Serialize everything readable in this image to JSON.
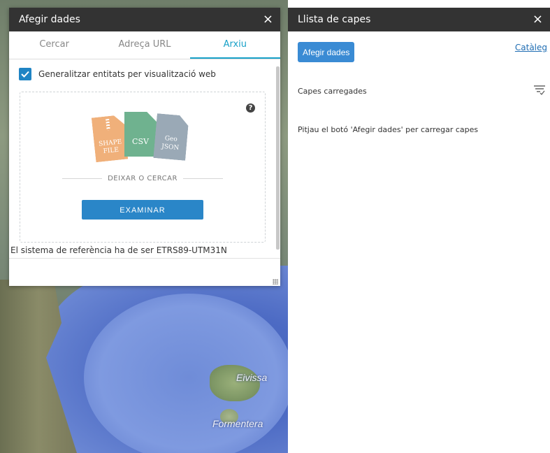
{
  "map": {
    "labels": {
      "eivissa": "Eivissa",
      "formentera": "Formentera"
    }
  },
  "add_data_panel": {
    "title": "Afegir dades",
    "close_icon": "×",
    "tabs": [
      {
        "label": "Cercar",
        "active": false
      },
      {
        "label": "Adreça URL",
        "active": false
      },
      {
        "label": "Arxiu",
        "active": true
      }
    ],
    "generalize_checkbox": {
      "label": "Generalitzar entitats per visualització web",
      "checked": true
    },
    "help_icon": "?",
    "file_types": {
      "shapefile_line1": "SHAPE",
      "shapefile_line2": "FILE",
      "csv": "CSV",
      "geojson_line1": "Geo",
      "geojson_line2": "JSON"
    },
    "drop_or_search": "DEIXAR O CERCAR",
    "browse_button": "EXAMINAR",
    "crs_note": "El sistema de referència ha de ser ETRS89-UTM31N"
  },
  "layer_list_panel": {
    "title": "Llista de capes",
    "close_icon": "×",
    "add_data_button": "Afegir dades",
    "catalog_link": "Catàleg",
    "loaded_layers_label": "Capes carregades",
    "empty_message": "Pitjau el botó 'Afegir dades' per carregar capes"
  },
  "colors": {
    "header_bg": "#333333",
    "accent": "#18a1c8",
    "button_blue": "#2a86c8"
  }
}
